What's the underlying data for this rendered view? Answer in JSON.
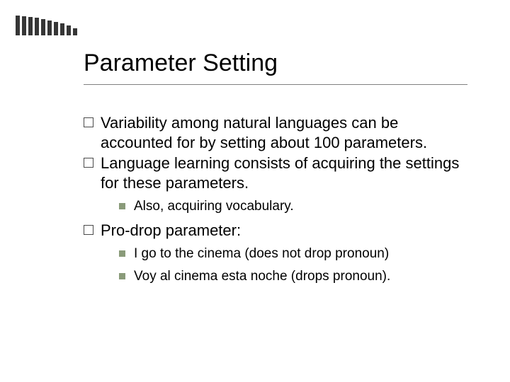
{
  "title": "Parameter Setting",
  "bullets": {
    "b1": "Variability among natural languages can be accounted for by setting about 100 parameters.",
    "b2": "Language learning consists of acquiring the settings for these parameters.",
    "b2_sub1": "Also, acquiring vocabulary.",
    "b3": "Pro-drop parameter:",
    "b3_sub1": "I go to the cinema (does not drop pronoun)",
    "b3_sub2": "Voy al cinema esta noche (drops pronoun)."
  }
}
